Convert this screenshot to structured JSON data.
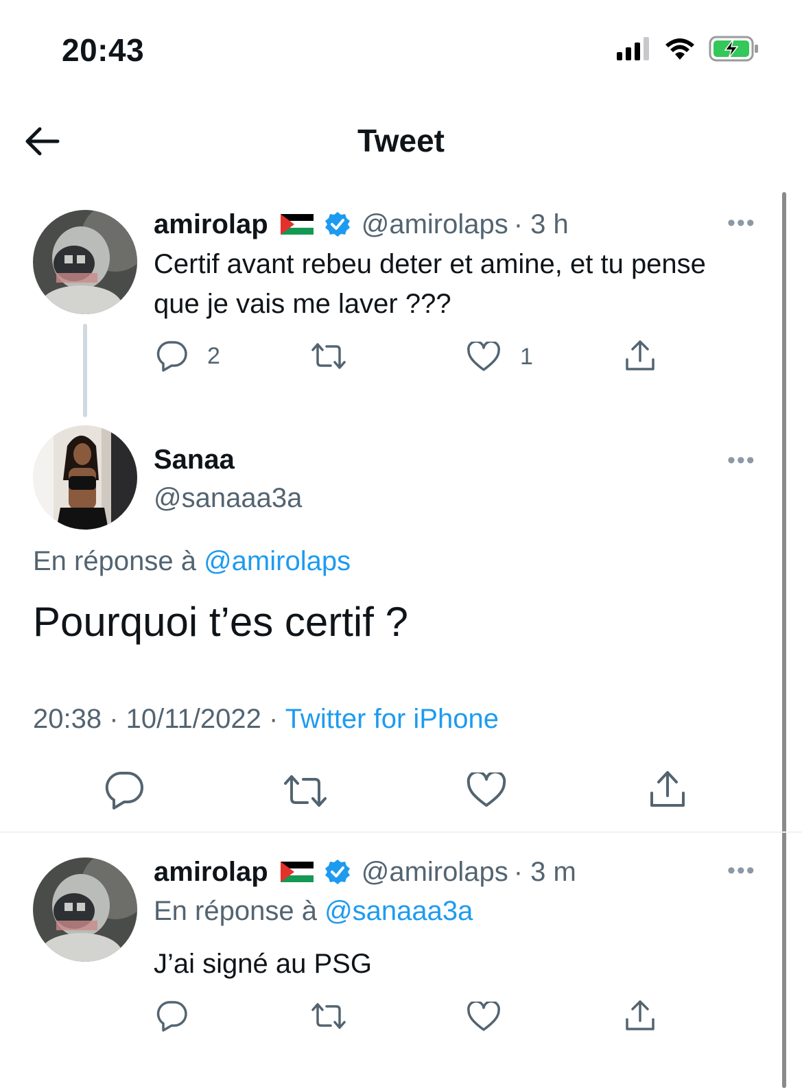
{
  "status_bar": {
    "time": "20:43"
  },
  "nav": {
    "title": "Tweet"
  },
  "colors": {
    "accent": "#1d9bf0",
    "text": "#0f1419",
    "secondary": "#536471"
  },
  "tweets": [
    {
      "name": "amirolap",
      "handle": "@amirolaps",
      "age": "· 3 h",
      "text": "Certif avant rebeu deter et amine, et tu pense que je vais me laver ???",
      "reply_count": "2",
      "like_count": "1"
    },
    {
      "name": "Sanaa",
      "handle": "@sanaaa3a",
      "reply_prefix": "En réponse à",
      "reply_to": "@amirolaps",
      "text": "Pourquoi t’es certif ?",
      "timestamp": "20:38 · 10/11/2022 ·",
      "source": "Twitter for iPhone"
    },
    {
      "name": "amirolap",
      "handle": "@amirolaps",
      "age": "· 3 m",
      "reply_prefix": "En réponse à",
      "reply_to": "@sanaaa3a",
      "text": "J’ai signé au PSG"
    }
  ],
  "icons": [
    "back-arrow-icon",
    "reply-icon",
    "retweet-icon",
    "like-icon",
    "share-icon",
    "verified-icon",
    "more-icon"
  ]
}
